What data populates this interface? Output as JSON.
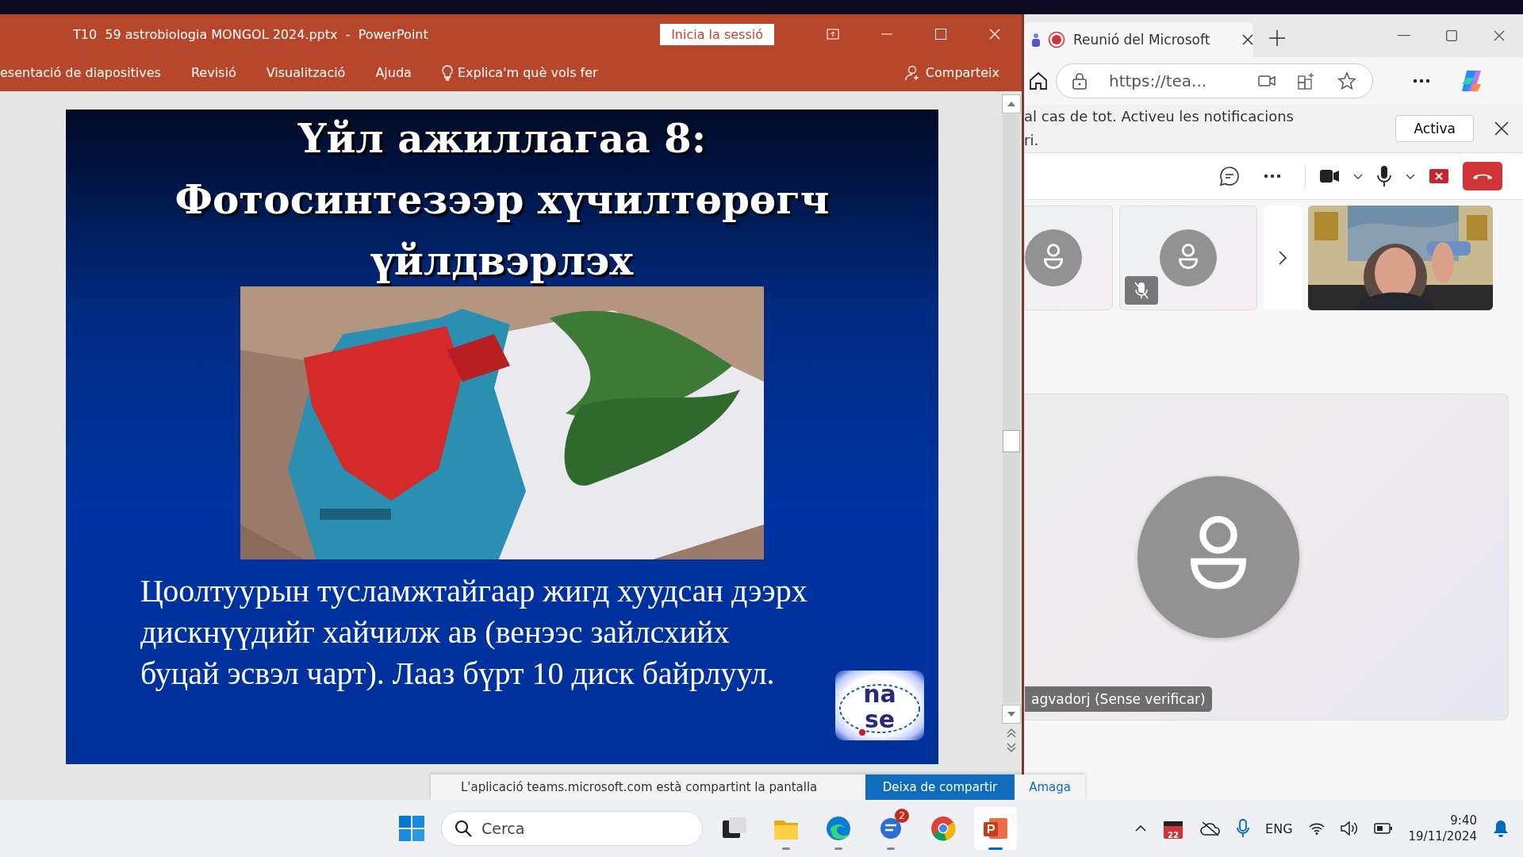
{
  "powerpoint": {
    "title": "T10  59 astrobiologia MONGOL 2024.pptx  -  PowerPoint",
    "sign_in": "Inicia la sessió",
    "ribbon_tabs": [
      {
        "label": "esentació de diapositives",
        "selected": false
      },
      {
        "label": "Revisió",
        "selected": false
      },
      {
        "label": "Visualització",
        "selected": false
      },
      {
        "label": "Ajuda",
        "selected": false
      }
    ],
    "tell_me": "Explica'm què vols fer",
    "share": "Comparteix",
    "slide": {
      "title_lines": [
        "Үйл ажиллагаа 8:",
        "Фотосинтезээр хүчилтөрөгч",
        "үйлдвэрлэх"
      ],
      "photo": {
        "kind": "picture"
      },
      "body_lines": [
        "Цоолтуурын тусламжтайгаар жигд хуудсан дээрх",
        "дискнүүдийг хайчилж ав (венээс зайлсхийх",
        "буцай эсвэл чарт). Лааз бүрт 10 диск байрлуул."
      ],
      "logo": [
        "na",
        "se"
      ]
    }
  },
  "browser": {
    "tab": {
      "title": "Reunió del Microsoft",
      "recording": true
    },
    "url": "https://tea...",
    "notification": {
      "lines": [
        "al cas de tot. Activeu les notificacions",
        "ri."
      ],
      "button": "Activa"
    },
    "meeting": {
      "tiles": [
        {
          "kind": "avatar",
          "muted": false
        },
        {
          "kind": "avatar",
          "muted": true
        },
        {
          "kind": "next"
        },
        {
          "kind": "video"
        }
      ],
      "stage_name": "agvadorj (Sense verificar)"
    }
  },
  "sharing_bar": {
    "message": "L'aplicació teams.microsoft.com està compartint la pantalla",
    "stop": "Deixa de compartir",
    "hide": "Amaga"
  },
  "taskbar": {
    "search": "Cerca",
    "apps": [
      {
        "kind": "taskview",
        "running": false
      },
      {
        "kind": "folder",
        "running": true
      },
      {
        "kind": "edge",
        "running": true
      },
      {
        "kind": "chat",
        "running": true,
        "badge": "2"
      },
      {
        "kind": "chrome",
        "running": false
      },
      {
        "kind": "powerpoint",
        "running": true,
        "selected": true
      }
    ],
    "calendar_day": "22",
    "language": "ENG",
    "time": "9:40",
    "date": "19/11/2024"
  }
}
